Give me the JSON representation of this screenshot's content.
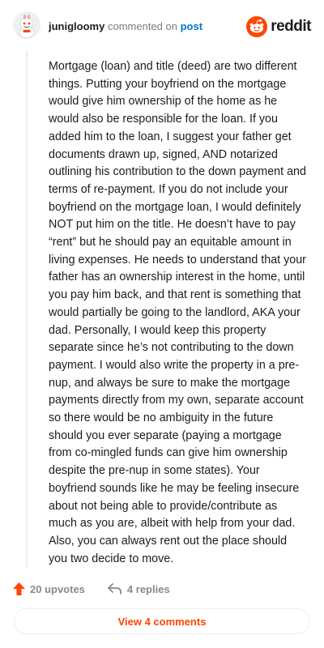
{
  "header": {
    "author": "junigloomy",
    "commented_text": "commented on",
    "post_link": "post",
    "brand_name": "reddit"
  },
  "comment": {
    "body": "Mortgage (loan) and title (deed) are two different things. Putting your boyfriend on the mortgage would give him ownership of the home as he would also be responsible for the loan. If you added him to the loan, I suggest your father get documents drawn up, signed, AND notarized outlining his contribution to the down payment and terms of re-payment. If you do not include your boyfriend on the mortgage loan, I would definitely NOT put him on the title. He doesn’t have to pay “rent” but he should pay an equitable amount in living expenses. He needs to understand that your father has an ownership interest in the home, until you pay him back, and that rent is something that would partially be going to the landlord, AKA your dad. Personally, I would keep this property separate since he’s not contributing to the down payment. I would also write the property in a pre-nup, and always be sure to make the mortgage payments directly from my own, separate account so there would be no ambiguity in the future should you ever separate (paying a mortgage from co-mingled funds can give him ownership despite the pre-nup in some states). Your boyfriend sounds like he may be feeling insecure about not being able to provide/contribute as much as you are, albeit with help from your dad. Also, you can always rent out the place should you two decide to move."
  },
  "actions": {
    "upvotes_label": "20 upvotes",
    "replies_label": "4 replies"
  },
  "footer": {
    "view_comments_label": "View 4 comments"
  },
  "colors": {
    "accent": "#ff4500",
    "link": "#0079d3",
    "muted": "#878a8c"
  },
  "icons": {
    "avatar": "snoo-avatar-icon",
    "brand": "reddit-logo-icon",
    "upvote": "upvote-arrow-icon",
    "reply": "reply-arrow-icon"
  }
}
